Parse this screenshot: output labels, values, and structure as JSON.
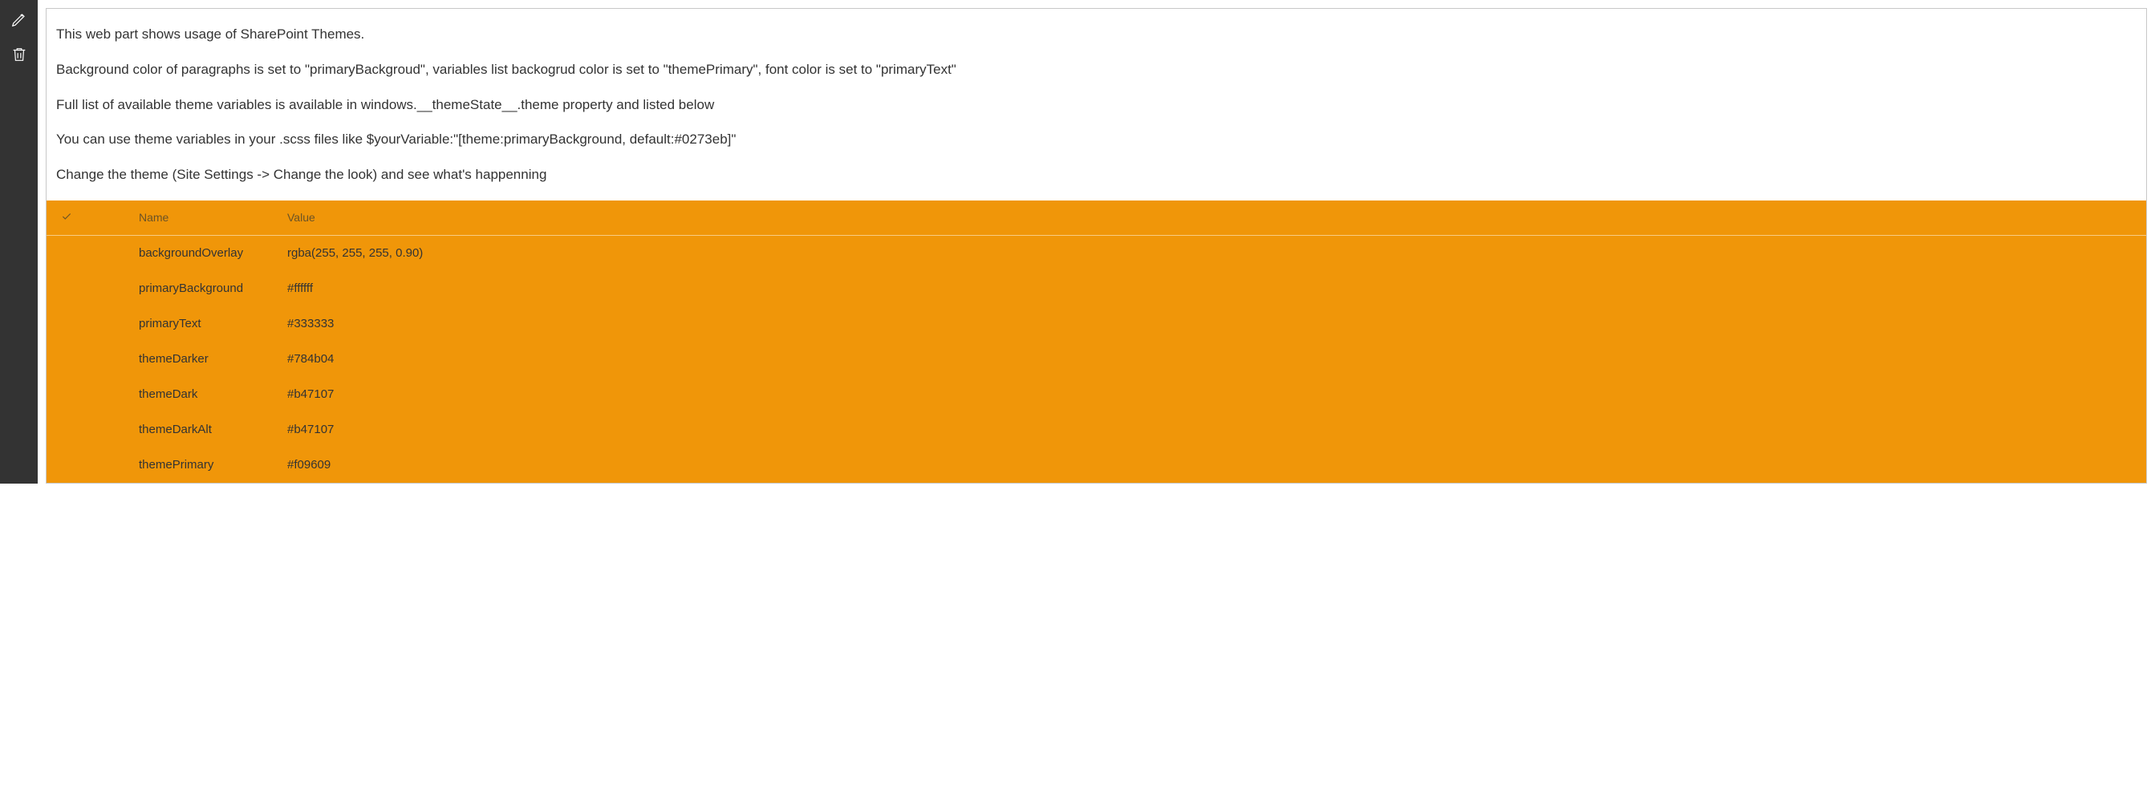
{
  "description": {
    "p1": "This web part shows usage of SharePoint Themes.",
    "p2": "Background color of paragraphs is set to \"primaryBackgroud\", variables list backogrud color is set to \"themePrimary\", font color is set to \"primaryText\"",
    "p3": "Full list of available theme variables is available in windows.__themeState__.theme property and listed below",
    "p4": "You can use theme variables in your .scss files like $yourVariable:\"[theme:primaryBackground, default:#0273eb]\"",
    "p5": "Change the theme (Site Settings -> Change the look) and see what's happenning"
  },
  "table": {
    "headers": {
      "name": "Name",
      "value": "Value"
    },
    "rows": [
      {
        "name": "backgroundOverlay",
        "value": "rgba(255, 255, 255, 0.90)"
      },
      {
        "name": "primaryBackground",
        "value": "#ffffff"
      },
      {
        "name": "primaryText",
        "value": "#333333"
      },
      {
        "name": "themeDarker",
        "value": "#784b04"
      },
      {
        "name": "themeDark",
        "value": "#b47107"
      },
      {
        "name": "themeDarkAlt",
        "value": "#b47107"
      },
      {
        "name": "themePrimary",
        "value": "#f09609"
      }
    ]
  },
  "colors": {
    "themePrimary": "#f09609",
    "primaryText": "#333333",
    "primaryBackground": "#ffffff"
  }
}
